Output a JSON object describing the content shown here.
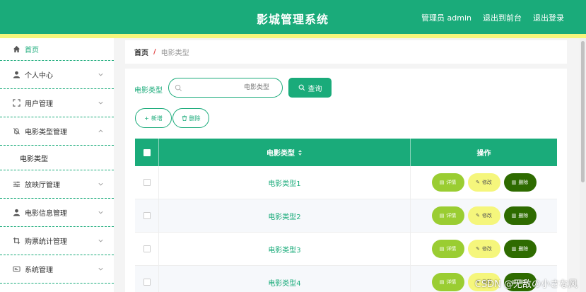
{
  "header": {
    "title": "影城管理系统",
    "user_label": "管理员 admin",
    "to_front": "退出到前台",
    "logout": "退出登录"
  },
  "sidebar": {
    "items": [
      {
        "label": "首页",
        "icon": "home-icon"
      },
      {
        "label": "个人中心",
        "icon": "user-icon"
      },
      {
        "label": "用户管理",
        "icon": "fullscreen-icon"
      },
      {
        "label": "电影类型管理",
        "icon": "bell-off-icon"
      },
      {
        "label": "放映厅管理",
        "icon": "sliders-icon"
      },
      {
        "label": "电影信息管理",
        "icon": "user-icon"
      },
      {
        "label": "购票统计管理",
        "icon": "crop-icon"
      },
      {
        "label": "系统管理",
        "icon": "card-icon"
      }
    ],
    "sub_item": "电影类型"
  },
  "breadcrumb": {
    "home": "首页",
    "sep": "/",
    "current": "电影类型"
  },
  "search": {
    "label": "电影类型",
    "placeholder": "电影类型",
    "query_button": "查询"
  },
  "actions": {
    "add": "新增",
    "delete": "删除"
  },
  "table": {
    "col_name": "电影类型",
    "col_op": "操作",
    "rows": [
      {
        "name": "电影类型1"
      },
      {
        "name": "电影类型2"
      },
      {
        "name": "电影类型3"
      },
      {
        "name": "电影类型4"
      }
    ],
    "btn_detail": "详情",
    "btn_edit": "修改",
    "btn_delete": "删除"
  },
  "watermark": "CSDN @无敌の小さな风",
  "colors": {
    "primary": "#1aab7a",
    "accent_yellow": "#f5f67c",
    "detail": "#9acd32",
    "delete": "#2e6b00"
  }
}
